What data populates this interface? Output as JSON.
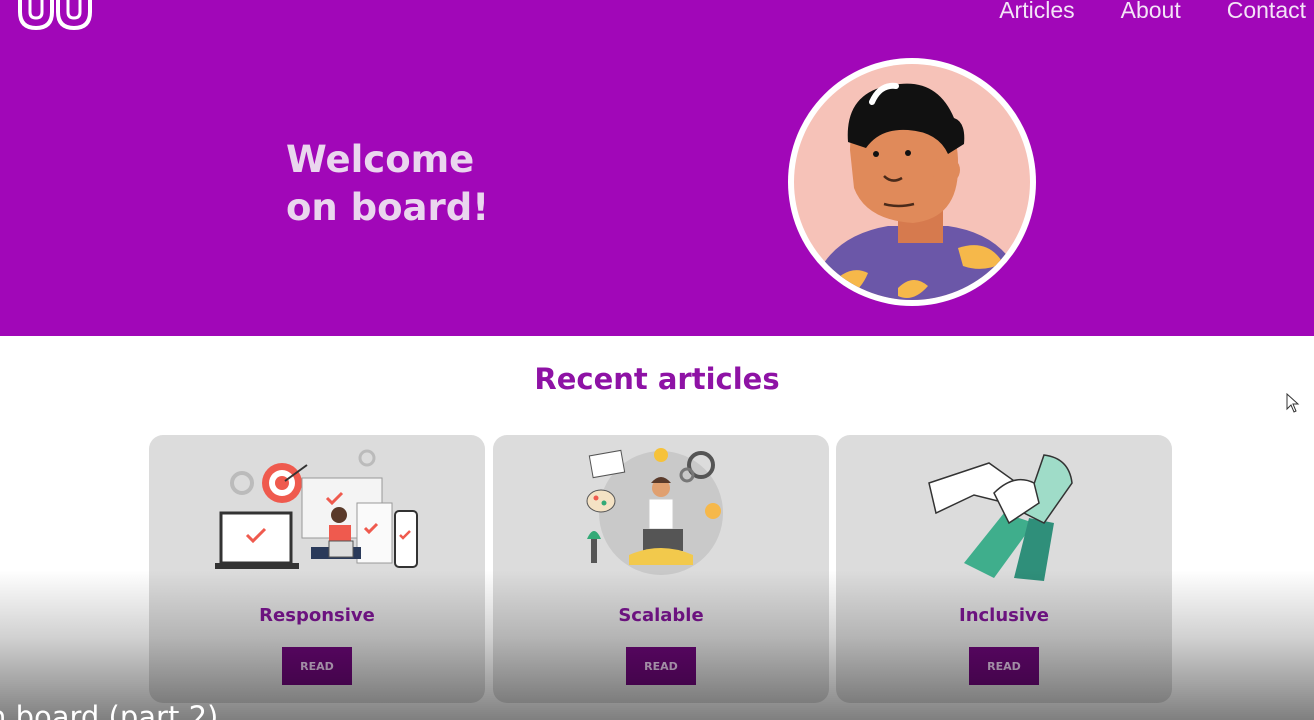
{
  "nav": {
    "articles": "Articles",
    "about": "About",
    "contact": "Contact"
  },
  "hero": {
    "line1": "Welcome",
    "line2": "on board!"
  },
  "section": {
    "title": "Recent articles"
  },
  "cards": [
    {
      "title": "Responsive",
      "button": "READ",
      "icon": "devices-illustration"
    },
    {
      "title": "Scalable",
      "button": "READ",
      "icon": "creative-person-illustration"
    },
    {
      "title": "Inclusive",
      "button": "READ",
      "icon": "stacked-hands-illustration"
    }
  ],
  "video_caption": "n board (part 2)",
  "colors": {
    "brand": "#a107b8",
    "title": "#8e12a5",
    "card_bg": "#dcdcdc",
    "button": "#6b0777"
  }
}
